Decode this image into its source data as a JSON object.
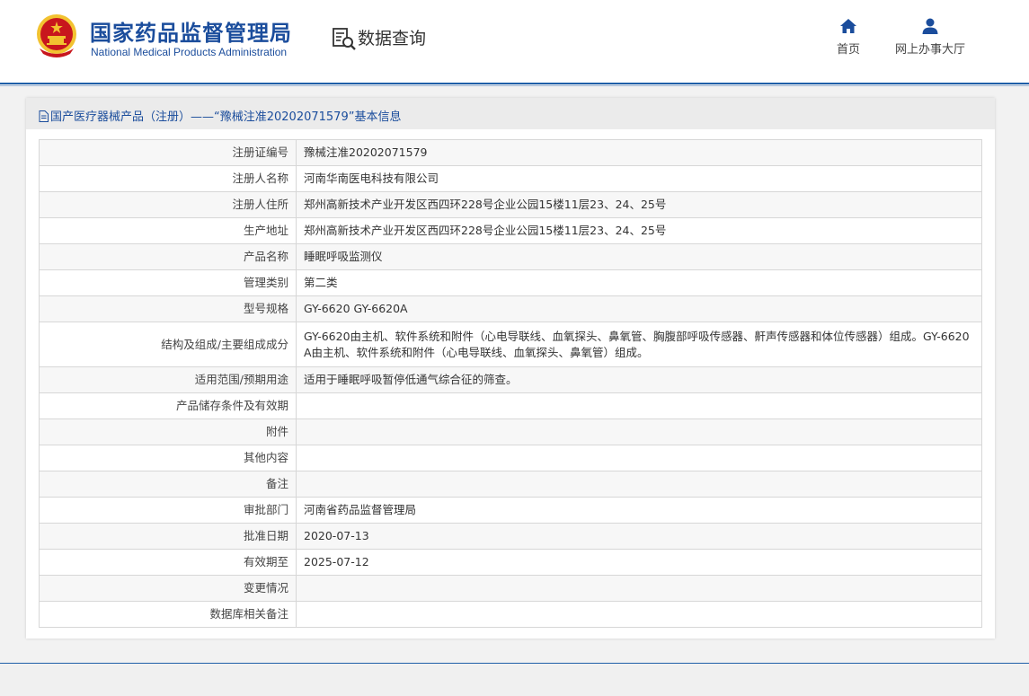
{
  "header": {
    "agency_cn": "国家药品监督管理局",
    "agency_en": "National Medical Products Administration",
    "section_title": "数据查询",
    "nav": [
      {
        "label": "首页",
        "icon": "home-icon"
      },
      {
        "label": "网上办事大厅",
        "icon": "user-icon"
      }
    ]
  },
  "card": {
    "title": "国产医疗器械产品（注册）——“豫械注准20202071579”基本信息",
    "rows": [
      {
        "key": "注册证编号",
        "value": "豫械注准20202071579"
      },
      {
        "key": "注册人名称",
        "value": "河南华南医电科技有限公司"
      },
      {
        "key": "注册人住所",
        "value": "郑州高新技术产业开发区西四环228号企业公园15楼11层23、24、25号"
      },
      {
        "key": "生产地址",
        "value": "郑州高新技术产业开发区西四环228号企业公园15楼11层23、24、25号"
      },
      {
        "key": "产品名称",
        "value": "睡眠呼吸监测仪"
      },
      {
        "key": "管理类别",
        "value": "第二类"
      },
      {
        "key": "型号规格",
        "value": "GY-6620 GY-6620A"
      },
      {
        "key": "结构及组成/主要组成成分",
        "value": "GY-6620由主机、软件系统和附件（心电导联线、血氧探头、鼻氧管、胸腹部呼吸传感器、鼾声传感器和体位传感器）组成。GY-6620A由主机、软件系统和附件（心电导联线、血氧探头、鼻氧管）组成。"
      },
      {
        "key": "适用范围/预期用途",
        "value": "适用于睡眠呼吸暂停低通气综合征的筛查。"
      },
      {
        "key": "产品储存条件及有效期",
        "value": ""
      },
      {
        "key": "附件",
        "value": ""
      },
      {
        "key": "其他内容",
        "value": ""
      },
      {
        "key": "备注",
        "value": ""
      },
      {
        "key": "审批部门",
        "value": "河南省药品监督管理局"
      },
      {
        "key": "批准日期",
        "value": "2020-07-13"
      },
      {
        "key": "有效期至",
        "value": "2025-07-12"
      },
      {
        "key": "变更情况",
        "value": ""
      },
      {
        "key": "数据库相关备注",
        "value": ""
      }
    ]
  },
  "colors": {
    "brand_blue": "#1b4d9c",
    "emblem_red": "#c8161d",
    "emblem_gold": "#f2c230"
  }
}
